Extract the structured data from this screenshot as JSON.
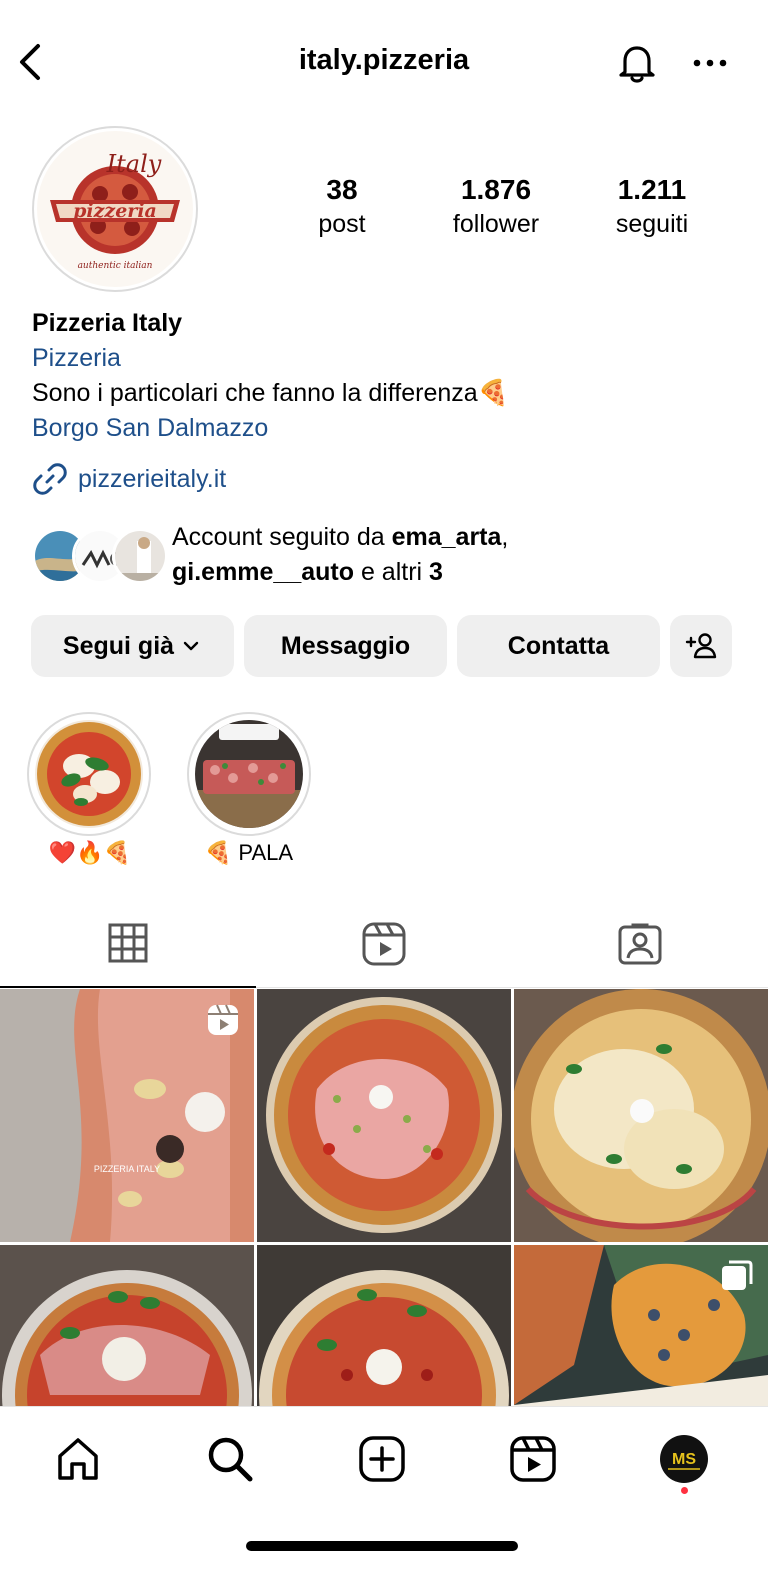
{
  "header": {
    "username": "italy.pizzeria"
  },
  "profile": {
    "avatar_text_top": "Italy",
    "avatar_text_main": "pizzeria",
    "avatar_text_sub": "authentic italian",
    "stats": [
      {
        "value": "38",
        "label": "post"
      },
      {
        "value": "1.876",
        "label": "follower"
      },
      {
        "value": "1.211",
        "label": "seguiti"
      }
    ],
    "name": "Pizzeria Italy",
    "category": "Pizzeria",
    "bio": "Sono i particolari che fanno la differenza🍕",
    "location": "Borgo San Dalmazzo",
    "website": "pizzerieitaly.it"
  },
  "followed_by": {
    "prefix": "Account seguito da ",
    "user1": "ema_arta",
    "sep": ",",
    "user2": "gi.emme__auto",
    "middle": " e altri ",
    "count": "3"
  },
  "actions": {
    "follow": "Segui già",
    "message": "Messaggio",
    "contact": "Contatta"
  },
  "highlights": [
    {
      "label": "❤️🔥🍕"
    },
    {
      "label": "🍕 PALA"
    }
  ],
  "grid_text": {
    "overlay1": "PIZZERIA ITALY"
  },
  "colors": {
    "link": "#1e4f8a",
    "button_bg": "#efefef",
    "notification_dot": "#ff3040"
  }
}
